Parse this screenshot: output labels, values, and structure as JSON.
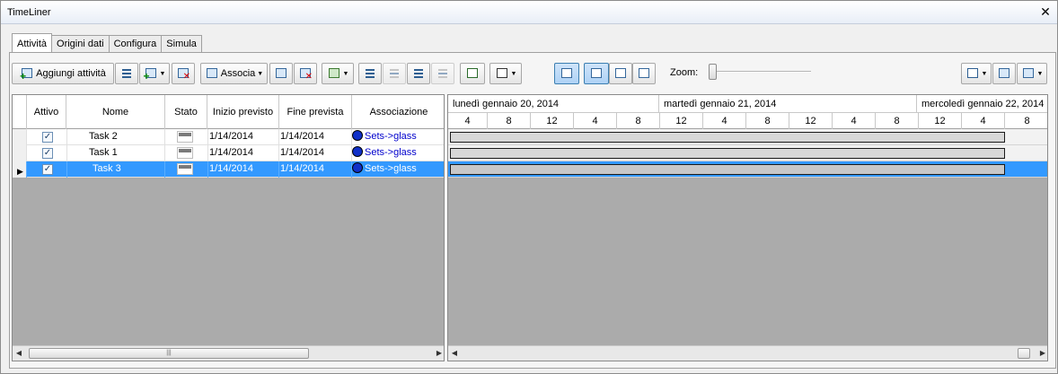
{
  "window": {
    "title": "TimeLiner",
    "close_glyph": "✕"
  },
  "tabs": [
    {
      "label": "Attività",
      "active": true
    },
    {
      "label": "Origini dati",
      "active": false
    },
    {
      "label": "Configura",
      "active": false
    },
    {
      "label": "Simula",
      "active": false
    }
  ],
  "toolbar": {
    "add_task_label": "Aggiungi attività",
    "attach_label": "Associa",
    "zoom_label": "Zoom:",
    "zoom_value": 0
  },
  "grid": {
    "columns": [
      "Attivo",
      "Nome",
      "Stato",
      "Inizio previsto",
      "Fine prevista",
      "Associazione"
    ],
    "rows": [
      {
        "active": true,
        "name": "Task 2",
        "start": "1/14/2014",
        "end": "1/14/2014",
        "assoc": "Sets->glass",
        "selected": false
      },
      {
        "active": true,
        "name": "Task 1",
        "start": "1/14/2014",
        "end": "1/14/2014",
        "assoc": "Sets->glass",
        "selected": false
      },
      {
        "active": true,
        "name": "Task 3",
        "start": "1/14/2014",
        "end": "1/14/2014",
        "assoc": "Sets->glass",
        "selected": true
      }
    ],
    "scroll_thumb_glyph": "|||"
  },
  "gantt": {
    "days": [
      "lunedì gennaio 20, 2014",
      "martedì gennaio 21, 2014",
      "mercoledì gennaio 22, 2014"
    ],
    "hours": [
      "4",
      "8",
      "12",
      "4",
      "8",
      "12",
      "4",
      "8",
      "12",
      "4",
      "8",
      "12",
      "4",
      "8"
    ]
  },
  "colors": {
    "selection": "#3399ff",
    "assoc_link": "#0000cc",
    "bar_border": "#1a1a1a"
  }
}
